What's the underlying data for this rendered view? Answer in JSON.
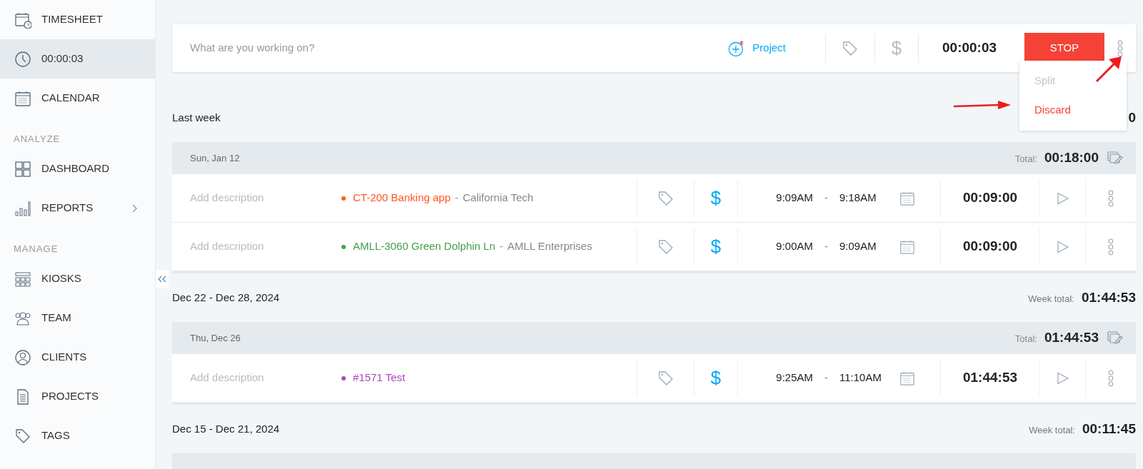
{
  "sidebar": {
    "items": [
      {
        "kind": "item",
        "label": "TIMESHEET",
        "selected": false
      },
      {
        "kind": "item",
        "label": "00:00:03",
        "selected": true
      },
      {
        "kind": "item",
        "label": "CALENDAR",
        "selected": false
      },
      {
        "kind": "section",
        "label": "ANALYZE"
      },
      {
        "kind": "item",
        "label": "DASHBOARD",
        "selected": false
      },
      {
        "kind": "item",
        "label": "REPORTS",
        "selected": false,
        "submenu": true
      },
      {
        "kind": "section",
        "label": "MANAGE"
      },
      {
        "kind": "item",
        "label": "KIOSKS",
        "selected": false
      },
      {
        "kind": "item",
        "label": "TEAM",
        "selected": false
      },
      {
        "kind": "item",
        "label": "CLIENTS",
        "selected": false
      },
      {
        "kind": "item",
        "label": "PROJECTS",
        "selected": false
      },
      {
        "kind": "item",
        "label": "TAGS",
        "selected": false
      }
    ]
  },
  "timer": {
    "placeholder": "What are you working on?",
    "project_label": "Project",
    "billable_label": "$",
    "billable": false,
    "time": "00:00:03",
    "stop_label": "STOP",
    "menu": [
      {
        "label": "Split",
        "disabled": true
      },
      {
        "label": "Discard",
        "disabled": false
      }
    ]
  },
  "weeks": [
    {
      "title": "Last week",
      "week_total": "0",
      "days": [
        {
          "date": "Sun, Jan 12",
          "total_label": "Total:",
          "total": "00:18:00",
          "entries": [
            {
              "description_placeholder": "Add description",
              "project": "CT-200 Banking app",
              "client_separator": "-",
              "client": "California Tech",
              "color": "#ff5722",
              "billable_label": "$",
              "billable": true,
              "start": "9:09AM",
              "time_separator": "-",
              "end": "9:18AM",
              "duration": "00:09:00"
            },
            {
              "description_placeholder": "Add description",
              "project": "AMLL-3060 Green Dolphin Ln",
              "client_separator": "-",
              "client": "AMLL Enterprises",
              "color": "#43a047",
              "billable_label": "$",
              "billable": true,
              "start": "9:00AM",
              "time_separator": "-",
              "end": "9:09AM",
              "duration": "00:09:00"
            }
          ]
        }
      ]
    },
    {
      "title": "Dec 22 - Dec 28, 2024",
      "week_total_label": "Week total:",
      "week_total": "01:44:53",
      "days": [
        {
          "date": "Thu, Dec 26",
          "total_label": "Total:",
          "total": "01:44:53",
          "entries": [
            {
              "description_placeholder": "Add description",
              "project": "#1571 Test",
              "color": "#ab47bc",
              "billable_label": "$",
              "billable": true,
              "start": "9:25AM",
              "time_separator": "-",
              "end": "11:10AM",
              "duration": "01:44:53"
            }
          ]
        }
      ]
    },
    {
      "title": "Dec 15 - Dec 21, 2024",
      "week_total_label": "Week total:",
      "week_total": "00:11:45"
    }
  ]
}
